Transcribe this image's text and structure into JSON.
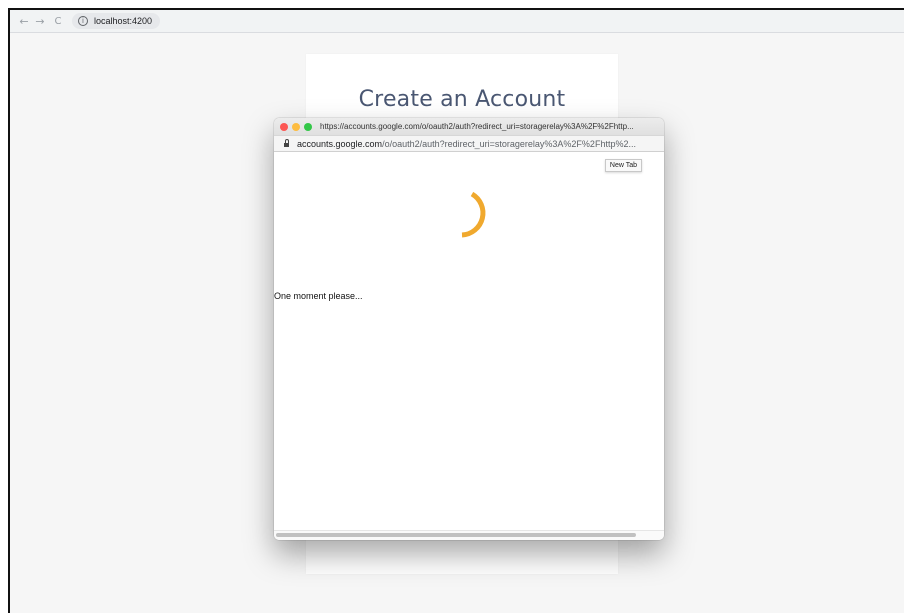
{
  "browser": {
    "back_icon": "arrow-left-icon",
    "forward_icon": "arrow-right-icon",
    "reload_icon": "reload-icon",
    "info_icon": "info-icon",
    "url": "localhost:4200"
  },
  "page": {
    "title": "Create an Account"
  },
  "popup": {
    "title_url": "https://accounts.google.com/o/oauth2/auth?redirect_uri=storagerelay%3A%2F%2Fhttp...",
    "address_host": "accounts.google.com",
    "address_path": "/o/oauth2/auth?redirect_uri=storagerelay%3A%2F%2Fhttp%2...",
    "tooltip": "New Tab",
    "loading_message": "One moment please...",
    "spinner_color": "#f0a92e",
    "traffic_lights": [
      "#fc5753",
      "#fdbc40",
      "#33c748"
    ]
  }
}
